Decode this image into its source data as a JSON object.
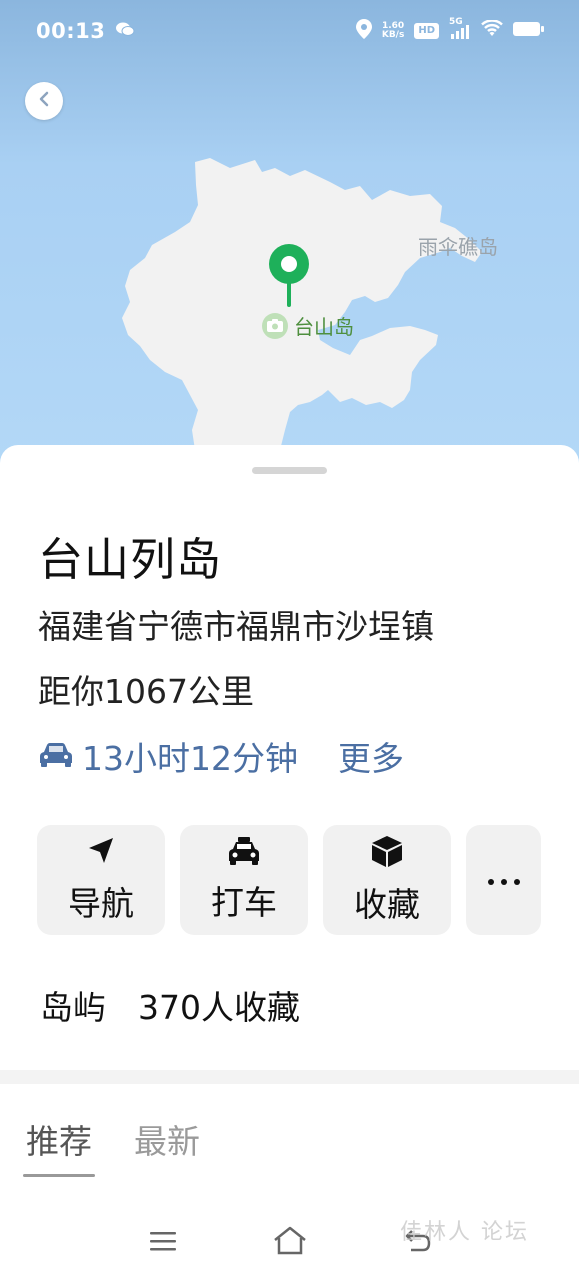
{
  "status_bar": {
    "time": "00:13",
    "speed_value": "1.60",
    "speed_unit": "KB/s",
    "hd": "HD",
    "network": "5G"
  },
  "map": {
    "minor_label": "雨伞礁岛",
    "main_label": "台山岛",
    "pin_color": "#1eb05a",
    "water_color": "#a9d0f3",
    "land_color": "#f2f2f2"
  },
  "place": {
    "name": "台山列岛",
    "address": "福建省宁德市福鼎市沙埕镇",
    "distance": "距你1067公里",
    "drive_time": "13小时12分钟",
    "more": "更多"
  },
  "actions": [
    {
      "label": "导航",
      "icon": "navigation-arrow-icon"
    },
    {
      "label": "打车",
      "icon": "taxi-icon"
    },
    {
      "label": "收藏",
      "icon": "box-icon"
    },
    {
      "label": "",
      "icon": "more-dots-icon"
    }
  ],
  "meta": {
    "category": "岛屿",
    "favorites": "370人收藏"
  },
  "tabs": [
    {
      "label": "推荐",
      "active": true
    },
    {
      "label": "最新",
      "active": false
    }
  ],
  "watermark": "佳林人 论坛"
}
